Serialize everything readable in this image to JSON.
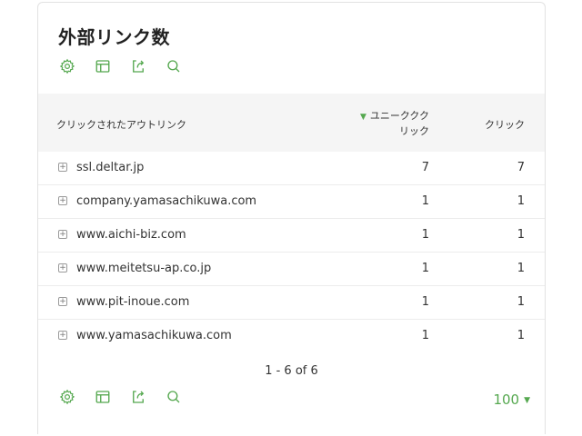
{
  "widget": {
    "title": "外部リンク数"
  },
  "toolbar": {
    "icons": [
      "gear-icon",
      "table-icon",
      "export-icon",
      "search-icon"
    ],
    "accent_color": "#55a84f"
  },
  "table": {
    "columns": {
      "label": "クリックされたアウトリンク",
      "unique_line1": "ユニーククク",
      "unique_line2": "リック",
      "clicks": "クリック"
    },
    "sort_indicator": "▼",
    "rows": [
      {
        "label": "ssl.deltar.jp",
        "unique": "7",
        "clicks": "7"
      },
      {
        "label": "company.yamasachikuwa.com",
        "unique": "1",
        "clicks": "1"
      },
      {
        "label": "www.aichi-biz.com",
        "unique": "1",
        "clicks": "1"
      },
      {
        "label": "www.meitetsu-ap.co.jp",
        "unique": "1",
        "clicks": "1"
      },
      {
        "label": "www.pit-inoue.com",
        "unique": "1",
        "clicks": "1"
      },
      {
        "label": "www.yamasachikuwa.com",
        "unique": "1",
        "clicks": "1"
      }
    ],
    "expand_symbol": "+"
  },
  "pagination": {
    "text": "1 - 6 of 6"
  },
  "limit": {
    "value": "100",
    "caret": "▼"
  }
}
